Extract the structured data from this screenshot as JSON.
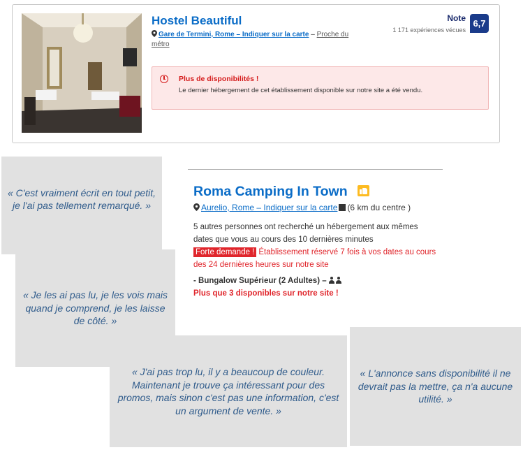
{
  "hostel": {
    "title": "Hostel Beautiful",
    "location_link": "Gare de Termini, Rome – Indiquer sur la carte",
    "location_sep": " – ",
    "location_extra": "Proche du métro",
    "note_label": "Note",
    "reviews": "1 171 expériences vécues",
    "score": "6,7",
    "alert_title": "Plus de disponibilités !",
    "alert_text": "Le dernier hébergement de cet établissement disponible sur notre site a été vendu."
  },
  "camping": {
    "title": "Roma Camping In Town",
    "location_link": "Aurelio, Rome – Indiquer sur la carte",
    "distance": "(6 km du centre )",
    "searched": "5 autres personnes ont recherché un hébergement aux mêmes dates que vous au cours des 10 dernières minutes",
    "demand_badge": "Forte demande !",
    "demand_text": "Établissement réservé 7 fois à vos dates au cours des 24 dernières heures sur notre site",
    "room": "- Bungalow Supérieur (2 Adultes)  –",
    "availability": "Plus que 3 disponibles sur notre site !"
  },
  "quotes": [
    "« C'est vraiment écrit en tout petit, je l'ai pas tellement remarqué. »",
    "« Je les ai pas lu, je les vois mais quand je comprend, je les laisse de côté. »",
    "« J'ai pas trop lu, il y a beaucoup de couleur. Maintenant je trouve ça intéressant pour des promos, mais sinon c'est pas une information, c'est un argument de vente. »",
    "« L'annonce sans disponibilité il ne devrait pas la mettre, ça n'a aucune utilité. »"
  ],
  "colors": {
    "link_blue": "#0a6cc7",
    "score_bg": "#1a3b8a",
    "alert_red": "#d51d1d",
    "demand_red": "#e0262c",
    "quote_text": "#2f5b8b",
    "quote_bg": "#e1e1e1"
  },
  "icons": [
    "map-pin-icon",
    "clock-icon",
    "thumbs-up-icon",
    "map-icon",
    "people-icon"
  ]
}
